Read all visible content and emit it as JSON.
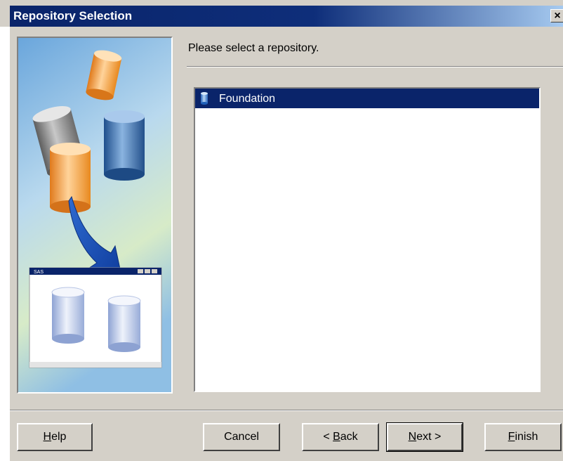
{
  "window": {
    "title": "Repository Selection",
    "close_glyph": "×"
  },
  "prompt": "Please select a repository.",
  "repositories": [
    {
      "label": "Foundation",
      "selected": true
    }
  ],
  "graphic": {
    "mini_window_title": "SAS"
  },
  "buttons": {
    "help": {
      "mnemonic": "H",
      "rest": "elp"
    },
    "cancel": {
      "label": "Cancel"
    },
    "back": {
      "prefix": "< ",
      "mnemonic": "B",
      "rest": "ack"
    },
    "next": {
      "mnemonic": "N",
      "rest": "ext >"
    },
    "finish": {
      "mnemonic": "F",
      "rest": "inish"
    }
  },
  "colors": {
    "title_bar": "#0a246a",
    "selection": "#0a246a",
    "face": "#d4d0c8"
  }
}
